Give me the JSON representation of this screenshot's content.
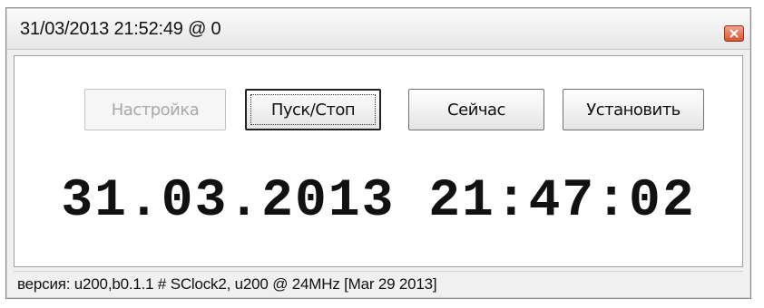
{
  "window": {
    "title": "31/03/2013 21:52:49 @ 0",
    "close_icon": "close-icon",
    "close_color": "#d9542e"
  },
  "toolbar": {
    "settings_label": "Настройка",
    "start_stop_label": "Пуск/Стоп",
    "now_label": "Сейчас",
    "set_label": "Установить"
  },
  "clock": {
    "display": "31.03.2013 21:47:02"
  },
  "status": {
    "text": "версия: u200,b0.1.1 # SClock2, u200 @ 24MHz [Mar 29 2013]"
  }
}
